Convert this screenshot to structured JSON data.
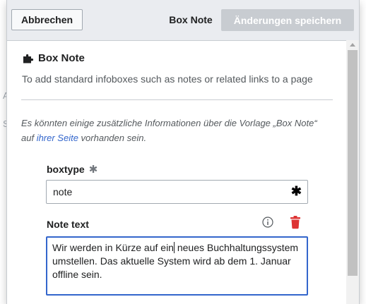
{
  "header": {
    "cancel_label": "Abbrechen",
    "title": "Box Note",
    "save_label": "Änderungen speichern"
  },
  "template": {
    "name": "Box Note",
    "description": "To add standard infoboxes such as notes or related links to a page",
    "info_note_prefix": "Es könnten einige zusätzliche Informationen über die Vorlage „Box Note“ auf ",
    "info_note_link": "ihrer Seite",
    "info_note_suffix": " vorhanden sein."
  },
  "params": {
    "boxtype": {
      "label": "boxtype",
      "required_marker": "✱",
      "value": "note",
      "value_icon": "✱"
    },
    "notetext": {
      "label": "Note text",
      "value_before_caret": "Wir werden in Kürze auf ein",
      "value_after_caret": " neues Buchhaltungssystem umstellen. Das aktuelle System wird ab dem 1. Januar offline sein."
    }
  },
  "background_fragments": [
    "A",
    "S"
  ],
  "icons": {
    "puzzle": "puzzle-icon",
    "info": "info-icon",
    "trash": "trash-icon"
  },
  "colors": {
    "accent": "#3366cc",
    "destructive": "#d33333",
    "header_bg": "#eaecf0",
    "disabled_button": "#c8ccd1"
  }
}
